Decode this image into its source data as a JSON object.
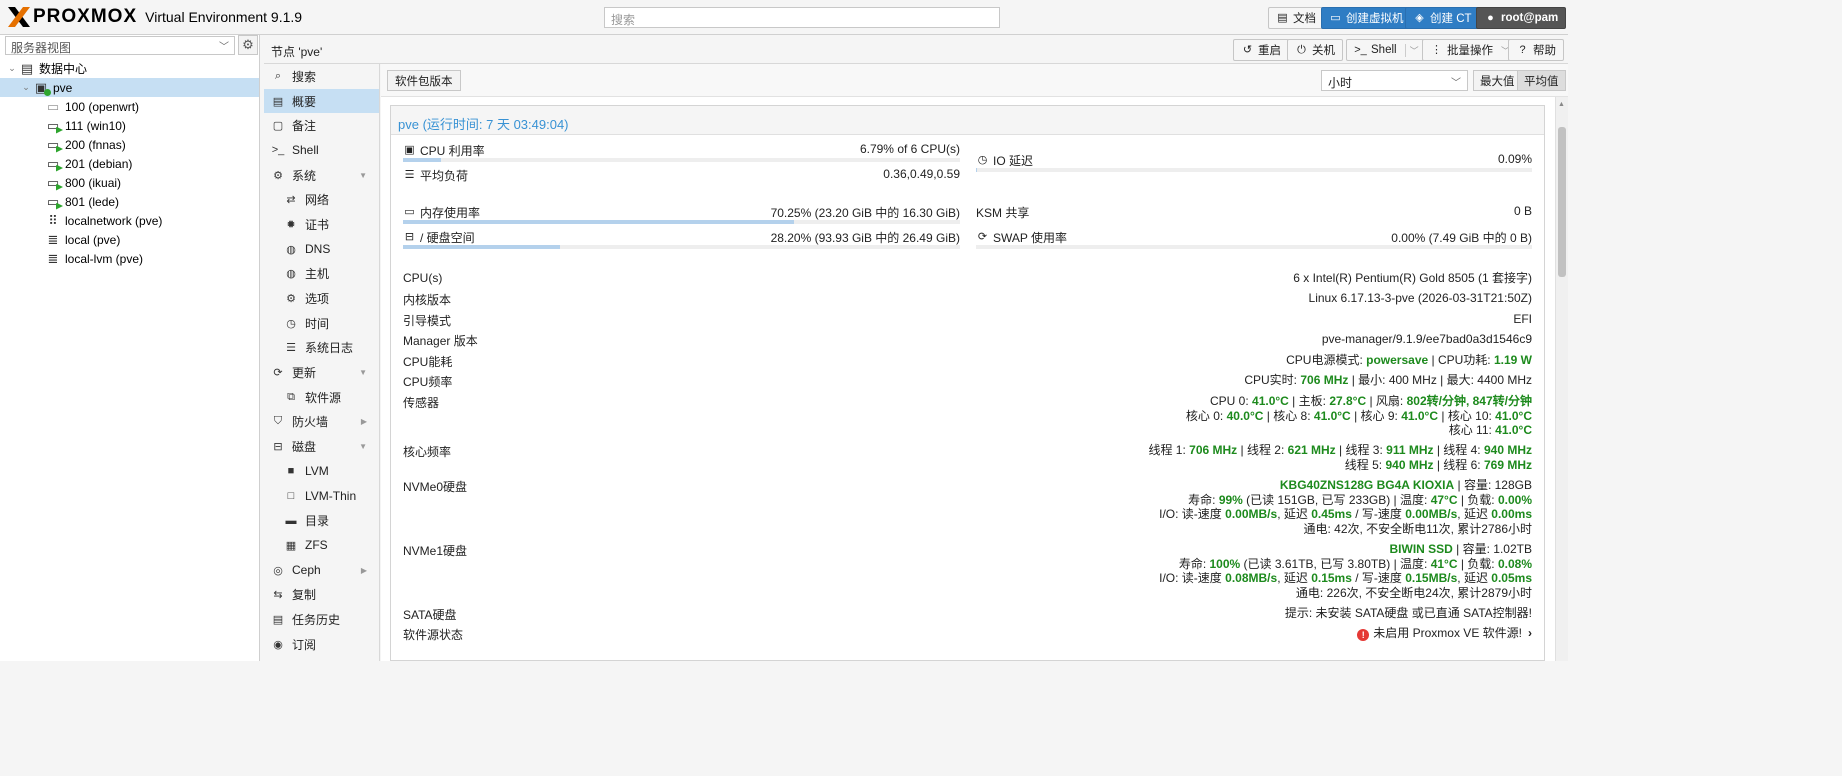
{
  "topbar": {
    "brand": "PROXMOX",
    "product": "Virtual Environment 9.1.9",
    "search_placeholder": "搜索",
    "docs": "文档",
    "create_vm": "创建虚拟机",
    "create_ct": "创建 CT",
    "user": "root@pam"
  },
  "sidebar": {
    "view": "服务器视图",
    "tree": [
      {
        "label": "数据中心",
        "type": "datacenter"
      },
      {
        "label": "pve",
        "type": "node",
        "selected": true
      },
      {
        "label": "100 (openwrt)",
        "type": "vm-stopped"
      },
      {
        "label": "111 (win10)",
        "type": "vm-running"
      },
      {
        "label": "200 (fnnas)",
        "type": "vm-running"
      },
      {
        "label": "201 (debian)",
        "type": "vm-running"
      },
      {
        "label": "800 (ikuai)",
        "type": "vm-running"
      },
      {
        "label": "801 (lede)",
        "type": "vm-running"
      },
      {
        "label": "localnetwork (pve)",
        "type": "network"
      },
      {
        "label": "local (pve)",
        "type": "storage"
      },
      {
        "label": "local-lvm (pve)",
        "type": "storage"
      }
    ]
  },
  "node_header": {
    "title": "节点 'pve'",
    "reboot": "重启",
    "shutdown": "关机",
    "shell": "Shell",
    "bulk": "批量操作",
    "help": "帮助"
  },
  "nav": [
    {
      "label": "搜索",
      "icon": "search-icon",
      "sub": false
    },
    {
      "label": "概要",
      "icon": "book-icon",
      "sub": false,
      "selected": true
    },
    {
      "label": "备注",
      "icon": "note-icon",
      "sub": false
    },
    {
      "label": "Shell",
      "icon": "terminal-icon",
      "sub": false
    },
    {
      "label": "系统",
      "icon": "gears-icon",
      "sub": false,
      "expand": "down"
    },
    {
      "label": "网络",
      "icon": "exchange-icon",
      "sub": true
    },
    {
      "label": "证书",
      "icon": "cert-icon",
      "sub": true
    },
    {
      "label": "DNS",
      "icon": "globe-icon",
      "sub": true
    },
    {
      "label": "主机",
      "icon": "globe-icon",
      "sub": true
    },
    {
      "label": "选项",
      "icon": "gear-icon",
      "sub": true
    },
    {
      "label": "时间",
      "icon": "clock-icon",
      "sub": true
    },
    {
      "label": "系统日志",
      "icon": "list-icon",
      "sub": true
    },
    {
      "label": "更新",
      "icon": "refresh-icon",
      "sub": false,
      "expand": "down"
    },
    {
      "label": "软件源",
      "icon": "files-icon",
      "sub": true
    },
    {
      "label": "防火墙",
      "icon": "shield-icon",
      "sub": false,
      "expand": "right"
    },
    {
      "label": "磁盘",
      "icon": "hdd-icon",
      "sub": false,
      "expand": "down"
    },
    {
      "label": "LVM",
      "icon": "square-icon",
      "sub": true
    },
    {
      "label": "LVM-Thin",
      "icon": "square-outline-icon",
      "sub": true
    },
    {
      "label": "目录",
      "icon": "folder-icon",
      "sub": true
    },
    {
      "label": "ZFS",
      "icon": "grid-icon",
      "sub": true
    },
    {
      "label": "Ceph",
      "icon": "ceph-icon",
      "sub": false,
      "expand": "right"
    },
    {
      "label": "复制",
      "icon": "retweet-icon",
      "sub": false
    },
    {
      "label": "任务历史",
      "icon": "list-alt-icon",
      "sub": false
    },
    {
      "label": "订阅",
      "icon": "support-icon",
      "sub": false
    }
  ],
  "content_toolbar": {
    "package_versions": "软件包版本",
    "timeframe": "小时",
    "max": "最大值",
    "avg": "平均值"
  },
  "status": {
    "title": "pve (运行时间: 7 天 03:49:04)",
    "cpu_label": "CPU 利用率",
    "cpu_value": "6.79% of 6 CPU(s)",
    "cpu_fraction": 0.0679,
    "load_label": "平均负荷",
    "load_value": "0.36,0.49,0.59",
    "io_label": "IO 延迟",
    "io_value": "0.09%",
    "io_fraction": 0.0009,
    "mem_label": "内存使用率",
    "mem_value": "70.25% (23.20 GiB 中的 16.30 GiB)",
    "mem_fraction": 0.7025,
    "ksm_label": "KSM 共享",
    "ksm_value": "0 B",
    "disk_label": "/ 硬盘空间",
    "disk_value": "28.20% (93.93 GiB 中的 26.49 GiB)",
    "disk_fraction": 0.282,
    "swap_label": "SWAP 使用率",
    "swap_value": "0.00% (7.49 GiB 中的 0 B)",
    "swap_fraction": 0.0
  },
  "details": {
    "cpus_k": "CPU(s)",
    "cpus_v": "6 x Intel(R) Pentium(R) Gold 8505 (1 套接字)",
    "kernel_k": "内核版本",
    "kernel_v": "Linux 6.17.13-3-pve (2026-03-31T21:50Z)",
    "boot_k": "引导模式",
    "boot_v": "EFI",
    "mgr_k": "Manager 版本",
    "mgr_v": "pve-manager/9.1.9/ee7bad0a3d1546c9",
    "power_k": "CPU能耗",
    "power_pre": "CPU电源模式: ",
    "power_mode": "powersave",
    "power_mid": " | CPU功耗: ",
    "power_watt": "1.19 W",
    "freq_k": "CPU频率",
    "freq_pre": "CPU实时: ",
    "freq_now": "706 MHz",
    "freq_rest": " | 最小: 400 MHz | 最大: 4400 MHz",
    "sensor_k": "传感器",
    "sensor_l1_a": "CPU 0: ",
    "sensor_l1_b": "41.0°C",
    "sensor_l1_c": " | 主板: ",
    "sensor_l1_d": "27.8°C",
    "sensor_l1_e": " | 风扇: ",
    "sensor_l1_f": "802转/分钟, 847转/分钟",
    "sensor_l2_a": "核心 0: ",
    "sensor_l2_b": "40.0°C",
    "sensor_l2_c": " | 核心 8: ",
    "sensor_l2_d": "41.0°C",
    "sensor_l2_e": " | 核心 9: ",
    "sensor_l2_f": "41.0°C",
    "sensor_l2_g": " | 核心 10: ",
    "sensor_l2_h": "41.0°C",
    "sensor_l3_a": "核心 11: ",
    "sensor_l3_b": "41.0°C",
    "core_k": "核心频率",
    "core_l1_a": "线程 1: ",
    "core_l1_b": "706 MHz",
    "core_l1_c": " | 线程 2: ",
    "core_l1_d": "621 MHz",
    "core_l1_e": " | 线程 3: ",
    "core_l1_f": "911 MHz",
    "core_l1_g": " | 线程 4: ",
    "core_l1_h": "940 MHz",
    "core_l2_a": "线程 5: ",
    "core_l2_b": "940 MHz",
    "core_l2_c": " | 线程 6: ",
    "core_l2_d": "769 MHz",
    "nvme0_k": "NVMe0硬盘",
    "nvme0_l1_a": "KBG40ZNS128G BG4A KIOXIA",
    "nvme0_l1_b": " | 容量: 128GB",
    "nvme0_l2_a": "寿命: ",
    "nvme0_l2_b": "99%",
    "nvme0_l2_c": " (已读 151GB, 已写 233GB) | 温度: ",
    "nvme0_l2_d": "47°C",
    "nvme0_l2_e": " | 负载: ",
    "nvme0_l2_f": "0.00%",
    "nvme0_l3_a": "I/O: 读-速度 ",
    "nvme0_l3_b": "0.00MB/s",
    "nvme0_l3_c": ", 延迟 ",
    "nvme0_l3_d": "0.45ms",
    "nvme0_l3_e": " / 写-速度 ",
    "nvme0_l3_f": "0.00MB/s",
    "nvme0_l3_g": ", 延迟 ",
    "nvme0_l3_h": "0.00ms",
    "nvme0_l4": "通电: 42次, 不安全断电11次, 累计2786小时",
    "nvme1_k": "NVMe1硬盘",
    "nvme1_l1_a": "BIWIN SSD",
    "nvme1_l1_b": " | 容量: 1.02TB",
    "nvme1_l2_a": "寿命: ",
    "nvme1_l2_b": "100%",
    "nvme1_l2_c": " (已读 3.61TB, 已写 3.80TB) | 温度: ",
    "nvme1_l2_d": "41°C",
    "nvme1_l2_e": " | 负载: ",
    "nvme1_l2_f": "0.08%",
    "nvme1_l3_a": "I/O: 读-速度 ",
    "nvme1_l3_b": "0.08MB/s",
    "nvme1_l3_c": ", 延迟 ",
    "nvme1_l3_d": "0.15ms",
    "nvme1_l3_e": " / 写-速度 ",
    "nvme1_l3_f": "0.15MB/s",
    "nvme1_l3_g": ", 延迟 ",
    "nvme1_l3_h": "0.05ms",
    "nvme1_l4": "通电: 226次, 不安全断电24次, 累计2879小时",
    "sata_k": "SATA硬盘",
    "sata_v": "提示: 未安装 SATA硬盘 或已直通 SATA控制器!",
    "repo_k": "软件源状态",
    "repo_v": "未启用 Proxmox VE 软件源!"
  },
  "colors": {
    "accent": "#3892d4",
    "green": "#1d8a1d",
    "selection": "#c6dff3",
    "create_button": "#2f7dc4",
    "logo_orange": "#e57000"
  }
}
